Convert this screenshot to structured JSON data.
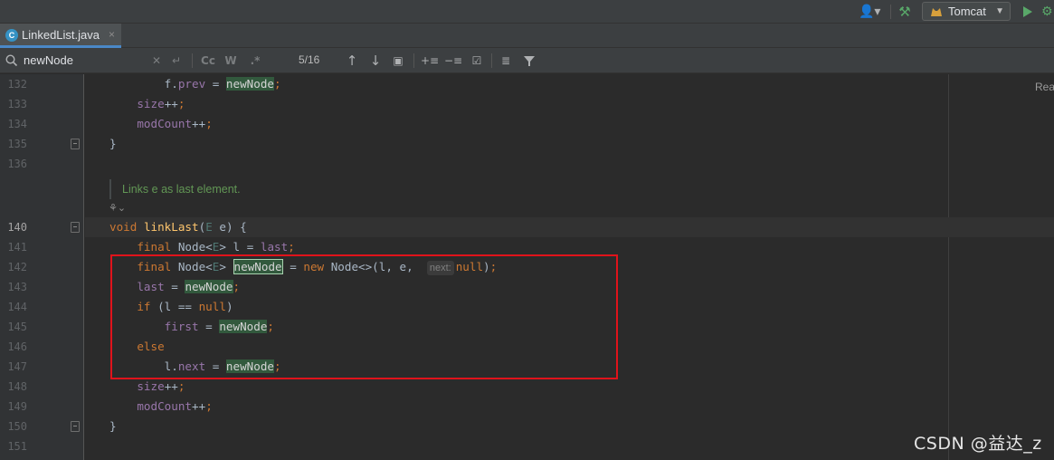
{
  "toolbar": {
    "user_icon": "user-icon",
    "build_icon": "hammer-icon",
    "run_config": "Tomcat",
    "run_icon": "play-icon",
    "debug_icon": "bug-icon"
  },
  "tab": {
    "label": "LinkedList.java",
    "close": "×"
  },
  "search": {
    "query": "newNode",
    "match_case": "Cc",
    "words": "W",
    "regex": ".*",
    "count": "5/16"
  },
  "editor": {
    "reader_mode": "Rea",
    "doc_comment": "Links e as last element.",
    "line_numbers": [
      "132",
      "133",
      "134",
      "135",
      "136",
      "140",
      "141",
      "142",
      "143",
      "144",
      "145",
      "146",
      "147",
      "148",
      "149",
      "150",
      "151"
    ],
    "inlay_hint": "next:"
  },
  "watermark": "CSDN @益达_z",
  "colors": {
    "highlight_box": "#e0131b",
    "match_bg": "#32593d",
    "keyword": "#cc7832",
    "field": "#9876aa"
  }
}
